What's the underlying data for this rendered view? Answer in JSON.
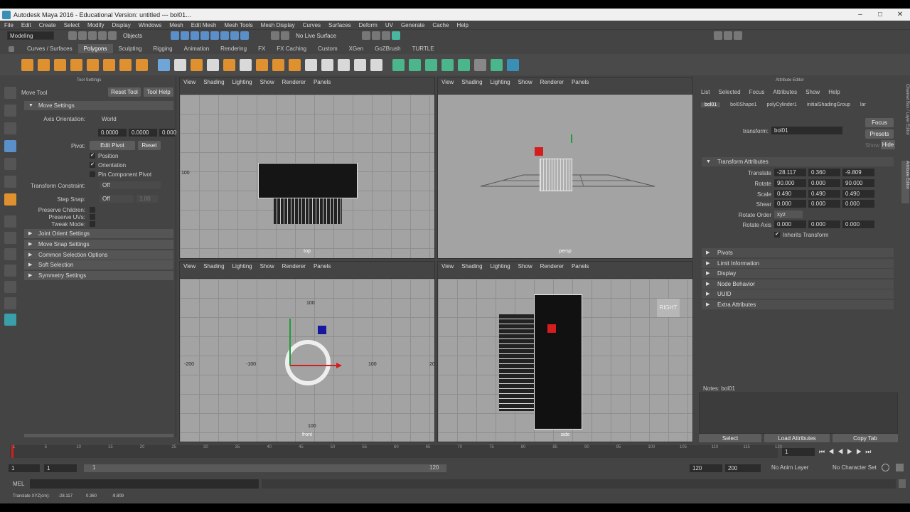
{
  "window": {
    "title": "Autodesk Maya 2016 - Educational Version: untitled  ---  bol01..."
  },
  "menubar": [
    "File",
    "Edit",
    "Create",
    "Select",
    "Modify",
    "Display",
    "Windows",
    "Mesh",
    "Edit Mesh",
    "Mesh Tools",
    "Mesh Display",
    "Curves",
    "Surfaces",
    "Deform",
    "UV",
    "Generate",
    "Cache",
    "Help"
  ],
  "status": {
    "menuset": "Modeling",
    "objects": "Objects",
    "live_surface": "No Live Surface"
  },
  "shelf_tabs": [
    "Curves / Surfaces",
    "Polygons",
    "Sculpting",
    "Rigging",
    "Animation",
    "Rendering",
    "FX",
    "FX Caching",
    "Custom",
    "XGen",
    "GoZBrush",
    "TURTLE"
  ],
  "tool_settings": {
    "panel_title": "Tool Settings",
    "tool_name": "Move Tool",
    "reset_tool": "Reset Tool",
    "tool_help": "Tool Help",
    "move_settings": "Move Settings",
    "axis_orientation_label": "Axis Orientation:",
    "axis_orientation_value": "World",
    "values": [
      "0.0000",
      "0.0000",
      "0.000"
    ],
    "pivot_label": "Pivot:",
    "edit_pivot": "Edit Pivot",
    "reset": "Reset",
    "position": "Position",
    "orientation": "Orientation",
    "pin_component_pivot": "Pin Component Pivot",
    "transform_constraint_label": "Transform Constraint:",
    "transform_constraint_value": "Off",
    "step_snap_label": "Step Snap:",
    "step_snap_value": "Off",
    "step_snap_amount": "1.00",
    "preserve_children": "Preserve Children:",
    "preserve_uvs": "Preserve UVs:",
    "tweak_mode": "Tweak Mode:",
    "sections": [
      "Joint Orient Settings",
      "Move Snap Settings",
      "Common Selection Options",
      "Soft Selection",
      "Symmetry Settings"
    ]
  },
  "viewport_menu": [
    "View",
    "Shading",
    "Lighting",
    "Show",
    "Renderer",
    "Panels"
  ],
  "viewports": {
    "top": {
      "camera": "top",
      "ticks": [
        "100"
      ]
    },
    "persp": {
      "camera": "persp"
    },
    "front": {
      "camera": "front",
      "ticks": [
        "100",
        "-200",
        "-100",
        "100",
        "20",
        "100"
      ]
    },
    "side": {
      "camera": "side",
      "view_cube": "RIGHT"
    }
  },
  "attribute_editor": {
    "panel_title": "Attribute Editor",
    "menu": [
      "List",
      "Selected",
      "Focus",
      "Attributes",
      "Show",
      "Help"
    ],
    "tabs": [
      "bol01",
      "bol0Shape1",
      "polyCylinder1",
      "initialShadingGroup",
      "lar"
    ],
    "transform_label": "transform:",
    "transform_value": "bol01",
    "focus": "Focus",
    "presets": "Presets",
    "show": "Show",
    "hide": "Hide",
    "transform_attributes": "Transform Attributes",
    "translate_label": "Translate",
    "translate": [
      "-28.117",
      "0.360",
      "-9.809"
    ],
    "rotate_label": "Rotate",
    "rotate": [
      "90.000",
      "0.000",
      "90.000"
    ],
    "scale_label": "Scale",
    "scale": [
      "0.490",
      "0.490",
      "0.490"
    ],
    "shear_label": "Shear",
    "shear": [
      "0.000",
      "0.000",
      "0.000"
    ],
    "rotate_order_label": "Rotate Order",
    "rotate_order": "xyz",
    "rotate_axis_label": "Rotate Axis",
    "rotate_axis": [
      "0.000",
      "0.000",
      "0.000"
    ],
    "inherits_transform": "Inherits Transform",
    "sections": [
      "Pivots",
      "Limit Information",
      "Display",
      "Node Behavior",
      "UUID",
      "Extra Attributes"
    ],
    "notes": "Notes:  bol01",
    "select_btn": "Select",
    "load_attributes_btn": "Load Attributes",
    "copy_tab_btn": "Copy Tab"
  },
  "side_strip": [
    "Channel Box / Layer Editor",
    "Attribute Editor"
  ],
  "timeline": {
    "ticks": [
      "1",
      "5",
      "10",
      "15",
      "20",
      "25",
      "30",
      "35",
      "40",
      "45",
      "50",
      "55",
      "60",
      "65",
      "70",
      "75",
      "80",
      "85",
      "90",
      "95",
      "100",
      "105",
      "110",
      "115",
      "120"
    ],
    "current_frame": "1"
  },
  "range": {
    "start": "1",
    "start2": "1",
    "slider_start": "1",
    "slider_end": "120",
    "end": "120",
    "end2": "200",
    "anim_layer": "No Anim Layer",
    "char_set": "No Character Set"
  },
  "cmd": {
    "label": "MEL"
  },
  "help_line": {
    "text": "Translate XYZ(cm):",
    "x": "-28.117",
    "y": "0.360",
    "z": "-9.809"
  }
}
